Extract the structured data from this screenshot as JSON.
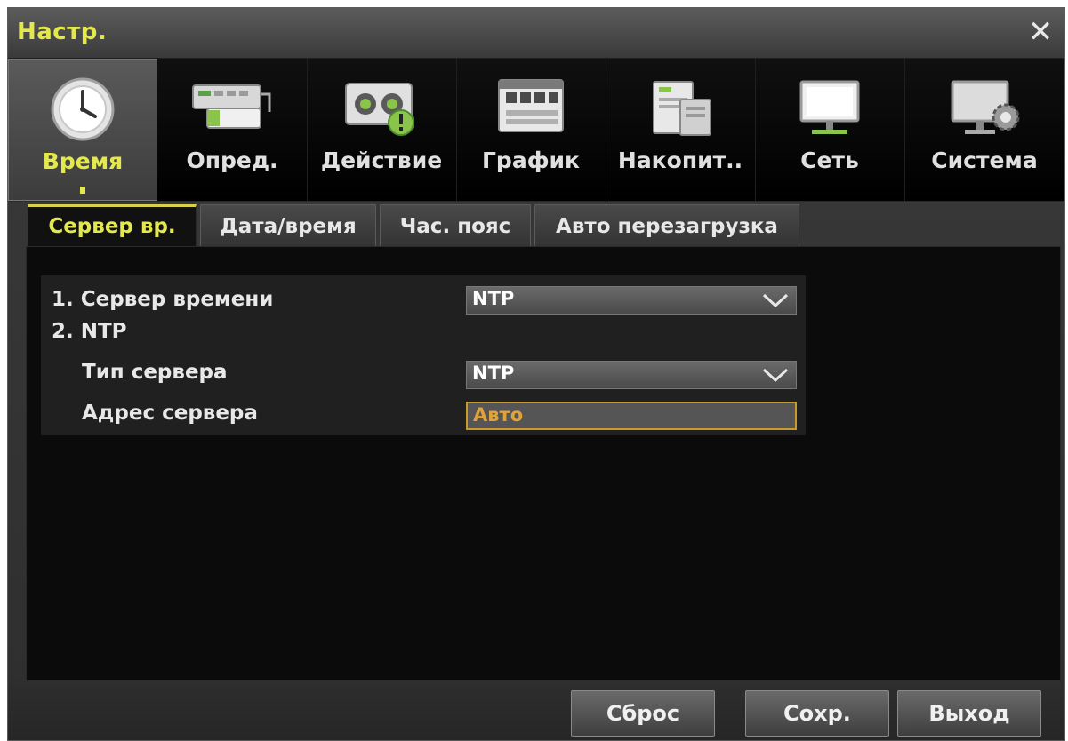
{
  "window": {
    "title": "Настр.",
    "close_glyph": "✕"
  },
  "categories": [
    {
      "label": "Время",
      "icon": "clock-icon",
      "active": true
    },
    {
      "label": "Опред.",
      "icon": "device-icon",
      "active": false
    },
    {
      "label": "Действие",
      "icon": "action-icon",
      "active": false
    },
    {
      "label": "График",
      "icon": "schedule-icon",
      "active": false
    },
    {
      "label": "Накопит..",
      "icon": "storage-icon",
      "active": false
    },
    {
      "label": "Сеть",
      "icon": "monitor-icon",
      "active": false
    },
    {
      "label": "Система",
      "icon": "system-gear-icon",
      "active": false
    }
  ],
  "tabs": [
    {
      "label": "Сервер вр.",
      "active": true
    },
    {
      "label": "Дата/время",
      "active": false
    },
    {
      "label": "Час. пояс",
      "active": false
    },
    {
      "label": "Авто перезагрузка",
      "active": false
    }
  ],
  "form": {
    "time_server_label": "1. Сервер времени",
    "time_server_value": "NTP",
    "ntp_heading": "2. NTP",
    "server_type_label": "Тип сервера",
    "server_type_value": "NTP",
    "server_address_label": "Адрес сервера",
    "server_address_value": "Авто"
  },
  "buttons": {
    "reset": "Сброс",
    "save": "Сохр.",
    "exit": "Выход"
  },
  "colors": {
    "accent": "#e3e94d",
    "focus_border": "#c89a2a",
    "focus_text": "#e0a23a"
  }
}
